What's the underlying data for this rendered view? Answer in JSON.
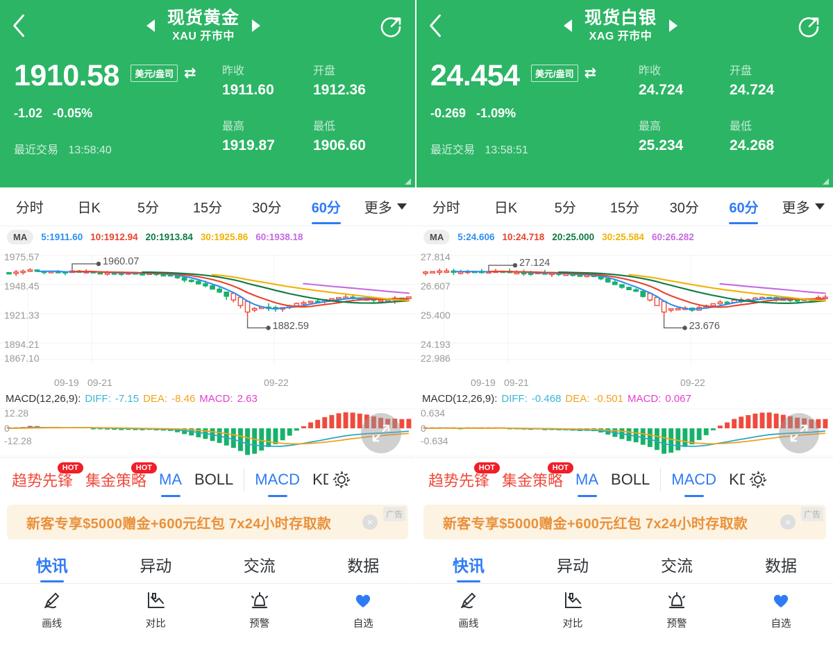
{
  "colors": {
    "header_green": "#2cb565",
    "accent_blue": "#2f7bf6",
    "ma5": "#2f8ef0",
    "ma10": "#e8432a",
    "ma20": "#0c7a43",
    "ma30": "#f2b100",
    "ma60": "#c56ae0",
    "up_green": "#17b26a",
    "down_red": "#ef4b3c",
    "hot_red": "#f01e28",
    "ad_orange": "#e9913a"
  },
  "panels": [
    {
      "header": {
        "back_icon": "chevron-left-icon",
        "prev_icon": "triangle-left-icon",
        "next_icon": "triangle-right-icon",
        "share_icon": "share-circle-icon",
        "title": "现货黄金",
        "subtitle": "XAU 开市中",
        "price": "1910.58",
        "unit": "美元/盎司",
        "swap_icon": "⇄",
        "change_abs": "-1.02",
        "change_pct": "-0.05%",
        "last_trade_label": "最近交易",
        "last_trade_time": "13:58:40",
        "stats": [
          {
            "label": "昨收",
            "value": "1911.60"
          },
          {
            "label": "开盘",
            "value": "1912.36"
          },
          {
            "label": "最高",
            "value": "1919.87"
          },
          {
            "label": "最低",
            "value": "1906.60"
          }
        ]
      },
      "period_tabs": [
        {
          "label": "分时",
          "active": false
        },
        {
          "label": "日K",
          "active": false
        },
        {
          "label": "5分",
          "active": false
        },
        {
          "label": "15分",
          "active": false
        },
        {
          "label": "30分",
          "active": false
        },
        {
          "label": "60分",
          "active": true
        },
        {
          "label": "更多",
          "active": false,
          "caret": true
        }
      ],
      "ma": {
        "chip": "MA",
        "items": [
          {
            "text": "5:1911.60",
            "color": "#2f8ef0"
          },
          {
            "text": "10:1912.94",
            "color": "#e8432a"
          },
          {
            "text": "20:1913.84",
            "color": "#0c7a43"
          },
          {
            "text": "30:1925.86",
            "color": "#f2b100"
          },
          {
            "text": "60:1938.18",
            "color": "#c56ae0"
          }
        ]
      },
      "macd": {
        "title": "MACD(12,26,9):",
        "diff_label": "DIFF:",
        "diff_value": "-7.15",
        "dea_label": "DEA:",
        "dea_value": "-8.46",
        "macd_label": "MACD:",
        "macd_value": "2.63",
        "y_top": "12.28",
        "y_zero": "0",
        "y_bottom": "-12.28",
        "expand_icon": "expand-arrows-icon"
      },
      "indicators": [
        {
          "label": "趋势先锋",
          "style": "red",
          "hot": "HOT"
        },
        {
          "label": "集金策略",
          "style": "red",
          "hot": "HOT"
        },
        {
          "label": "MA",
          "style": "blue"
        },
        {
          "label": "BOLL",
          "style": "plain"
        },
        {
          "label": "MACD",
          "style": "blue"
        },
        {
          "label": "KD",
          "style": "clip"
        }
      ],
      "gear_icon": "gear-icon",
      "ad": {
        "text": "新客专享$5000赠金+600元红包  7x24小时存取款",
        "close_icon": "×",
        "badge": "广告"
      },
      "bottom_tabs": [
        {
          "label": "快讯",
          "active": true
        },
        {
          "label": "异动",
          "active": false
        },
        {
          "label": "交流",
          "active": false
        },
        {
          "label": "数据",
          "active": false
        }
      ],
      "bottom_nav": [
        {
          "label": "画线",
          "icon": "pen-draw-icon",
          "active": false
        },
        {
          "label": "对比",
          "icon": "compare-chart-icon",
          "active": false
        },
        {
          "label": "预警",
          "icon": "alarm-icon",
          "active": false
        },
        {
          "label": "自选",
          "icon": "heart-icon",
          "active": true
        }
      ],
      "chart_data": {
        "type": "line",
        "title": "现货黄金 60分 K线",
        "y_ticks": [
          "1975.57",
          "1948.45",
          "1921.33",
          "1894.21",
          "1867.10"
        ],
        "ylim": [
          1867.1,
          1975.57
        ],
        "x_ticks": [
          "09-19",
          "09-21",
          "09-22"
        ],
        "annotations": [
          {
            "text": "1960.07",
            "kind": "high-marker"
          },
          {
            "text": "1882.59",
            "kind": "low-marker"
          }
        ],
        "series": [
          {
            "name": "MA5",
            "color": "#2f8ef0"
          },
          {
            "name": "MA10",
            "color": "#e8432a"
          },
          {
            "name": "MA20",
            "color": "#0c7a43"
          },
          {
            "name": "MA30",
            "color": "#f2b100"
          },
          {
            "name": "MA60",
            "color": "#c56ae0"
          }
        ],
        "macd_panel": {
          "ylim": [
            -12.28,
            12.28
          ],
          "zero": 0
        }
      }
    },
    {
      "header": {
        "back_icon": "chevron-left-icon",
        "prev_icon": "triangle-left-icon",
        "next_icon": "triangle-right-icon",
        "share_icon": "share-circle-icon",
        "title": "现货白银",
        "subtitle": "XAG 开市中",
        "price": "24.454",
        "unit": "美元/盎司",
        "swap_icon": "⇄",
        "change_abs": "-0.269",
        "change_pct": "-1.09%",
        "last_trade_label": "最近交易",
        "last_trade_time": "13:58:51",
        "stats": [
          {
            "label": "昨收",
            "value": "24.724"
          },
          {
            "label": "开盘",
            "value": "24.724"
          },
          {
            "label": "最高",
            "value": "25.234"
          },
          {
            "label": "最低",
            "value": "24.268"
          }
        ]
      },
      "period_tabs": [
        {
          "label": "分时",
          "active": false
        },
        {
          "label": "日K",
          "active": false
        },
        {
          "label": "5分",
          "active": false
        },
        {
          "label": "15分",
          "active": false
        },
        {
          "label": "30分",
          "active": false
        },
        {
          "label": "60分",
          "active": true
        },
        {
          "label": "更多",
          "active": false,
          "caret": true
        }
      ],
      "ma": {
        "chip": "MA",
        "items": [
          {
            "text": "5:24.606",
            "color": "#2f8ef0"
          },
          {
            "text": "10:24.718",
            "color": "#e8432a"
          },
          {
            "text": "20:25.000",
            "color": "#0c7a43"
          },
          {
            "text": "30:25.584",
            "color": "#f2b100"
          },
          {
            "text": "60:26.282",
            "color": "#c56ae0"
          }
        ]
      },
      "macd": {
        "title": "MACD(12,26,9):",
        "diff_label": "DIFF:",
        "diff_value": "-0.468",
        "dea_label": "DEA:",
        "dea_value": "-0.501",
        "macd_label": "MACD:",
        "macd_value": "0.067",
        "y_top": "0.634",
        "y_zero": "0",
        "y_bottom": "-0.634",
        "expand_icon": "expand-arrows-icon"
      },
      "indicators": [
        {
          "label": "趋势先锋",
          "style": "red",
          "hot": "HOT"
        },
        {
          "label": "集金策略",
          "style": "red",
          "hot": "HOT"
        },
        {
          "label": "MA",
          "style": "blue"
        },
        {
          "label": "BOLL",
          "style": "plain"
        },
        {
          "label": "MACD",
          "style": "blue"
        },
        {
          "label": "KD",
          "style": "clip"
        }
      ],
      "gear_icon": "gear-icon",
      "ad": {
        "text": "新客专享$5000赠金+600元红包  7x24小时存取款",
        "close_icon": "×",
        "badge": "广告"
      },
      "bottom_tabs": [
        {
          "label": "快讯",
          "active": true
        },
        {
          "label": "异动",
          "active": false
        },
        {
          "label": "交流",
          "active": false
        },
        {
          "label": "数据",
          "active": false
        }
      ],
      "bottom_nav": [
        {
          "label": "画线",
          "icon": "pen-draw-icon",
          "active": false
        },
        {
          "label": "对比",
          "icon": "compare-chart-icon",
          "active": false
        },
        {
          "label": "预警",
          "icon": "alarm-icon",
          "active": false
        },
        {
          "label": "自选",
          "icon": "heart-icon",
          "active": true
        }
      ],
      "chart_data": {
        "type": "line",
        "title": "现货白银 60分 K线",
        "y_ticks": [
          "27.814",
          "26.607",
          "25.400",
          "24.193",
          "22.986"
        ],
        "ylim": [
          22.986,
          27.814
        ],
        "x_ticks": [
          "09-19",
          "09-21",
          "09-22"
        ],
        "annotations": [
          {
            "text": "27.124",
            "kind": "high-marker"
          },
          {
            "text": "23.676",
            "kind": "low-marker"
          }
        ],
        "series": [
          {
            "name": "MA5",
            "color": "#2f8ef0"
          },
          {
            "name": "MA10",
            "color": "#e8432a"
          },
          {
            "name": "MA20",
            "color": "#0c7a43"
          },
          {
            "name": "MA30",
            "color": "#f2b100"
          },
          {
            "name": "MA60",
            "color": "#c56ae0"
          }
        ],
        "macd_panel": {
          "ylim": [
            -0.634,
            0.634
          ],
          "zero": 0
        }
      }
    }
  ]
}
